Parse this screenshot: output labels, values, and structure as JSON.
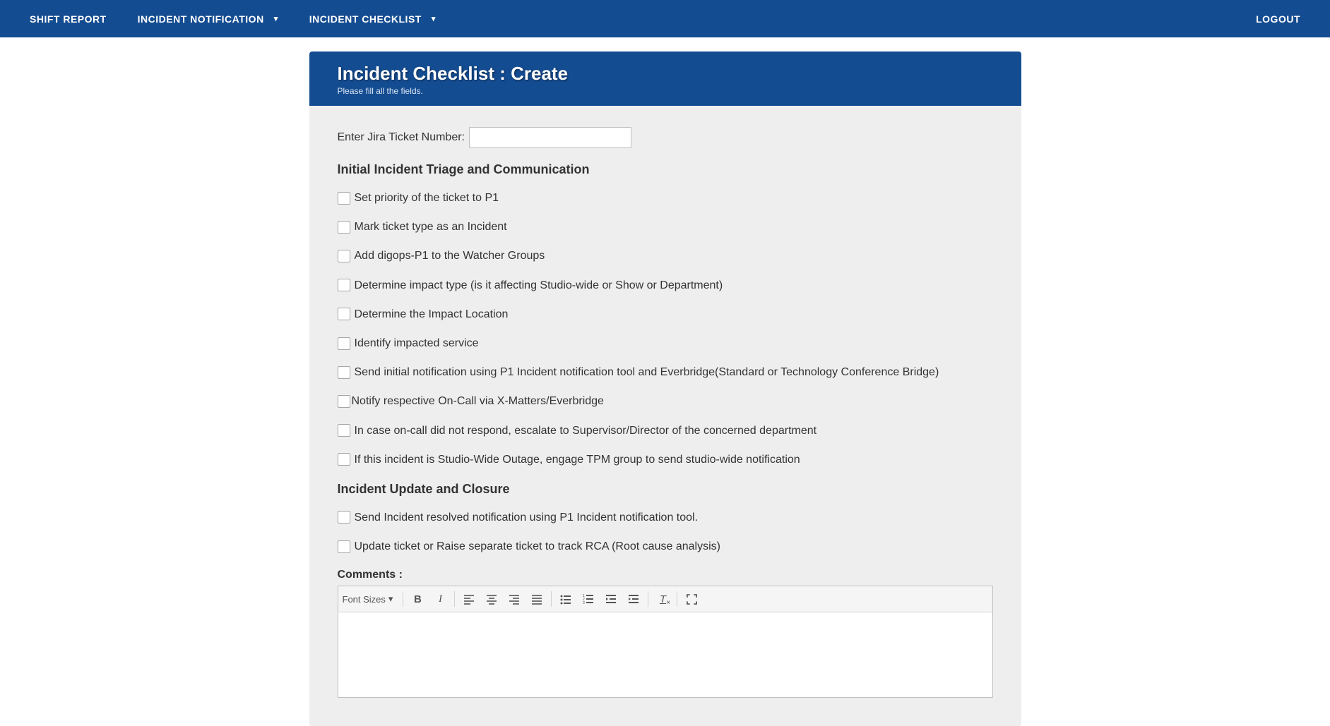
{
  "nav": {
    "shift_report": "SHIFT REPORT",
    "incident_notification": "INCIDENT NOTIFICATION",
    "incident_checklist": "INCIDENT CHECKLIST",
    "logout": "LOGOUT"
  },
  "panel": {
    "title": "Incident Checklist : Create",
    "subtitle": "Please fill all the fields."
  },
  "form": {
    "jira_label": "Enter Jira Ticket Number:",
    "jira_value": ""
  },
  "section1": {
    "heading": "Initial Incident Triage and Communication",
    "items": [
      "Set priority of the ticket to P1",
      "Mark ticket type as an Incident",
      "Add digops-P1 to the Watcher Groups",
      "Determine impact type (is it affecting Studio-wide or Show or Department)",
      "Determine the Impact Location",
      "Identify impacted service",
      "Send initial notification using P1 Incident notification tool and Everbridge(Standard or Technology Conference Bridge)",
      "Notify respective On-Call via X-Matters/Everbridge",
      "In case on-call did not respond, escalate to Supervisor/Director of the concerned department",
      "If this incident is Studio-Wide Outage, engage TPM group to send studio-wide notification"
    ]
  },
  "section2": {
    "heading": "Incident Update and Closure",
    "items": [
      "Send Incident resolved notification using P1 Incident notification tool.",
      "Update ticket or Raise separate ticket to track RCA (Root cause analysis)"
    ]
  },
  "comments": {
    "label": "Comments :",
    "font_sizes": "Font Sizes"
  }
}
